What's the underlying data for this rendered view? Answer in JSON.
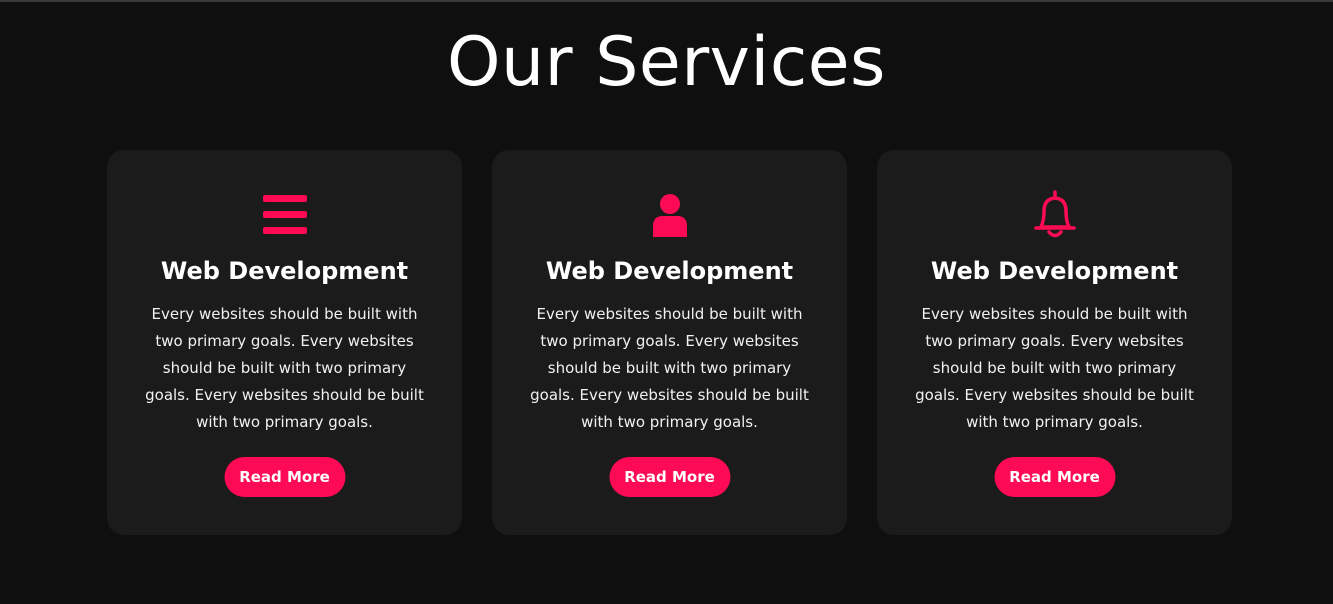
{
  "section": {
    "title": "Our Services"
  },
  "colors": {
    "background": "#0f0f0f",
    "card": "#1b1b1b",
    "accent": "#ff0a54",
    "text": "#ffffff"
  },
  "cards": [
    {
      "icon": "menu-bars-icon",
      "title": "Web Development",
      "text": "Every websites should be built with two primary goals. Every websites should be built with two primary goals. Every websites should be built with two primary goals.",
      "button_label": "Read More"
    },
    {
      "icon": "user-icon",
      "title": "Web Development",
      "text": "Every websites should be built with two primary goals. Every websites should be built with two primary goals. Every websites should be built with two primary goals.",
      "button_label": "Read More"
    },
    {
      "icon": "bell-icon",
      "title": "Web Development",
      "text": "Every websites should be built with two primary goals. Every websites should be built with two primary goals. Every websites should be built with two primary goals.",
      "button_label": "Read More"
    }
  ]
}
